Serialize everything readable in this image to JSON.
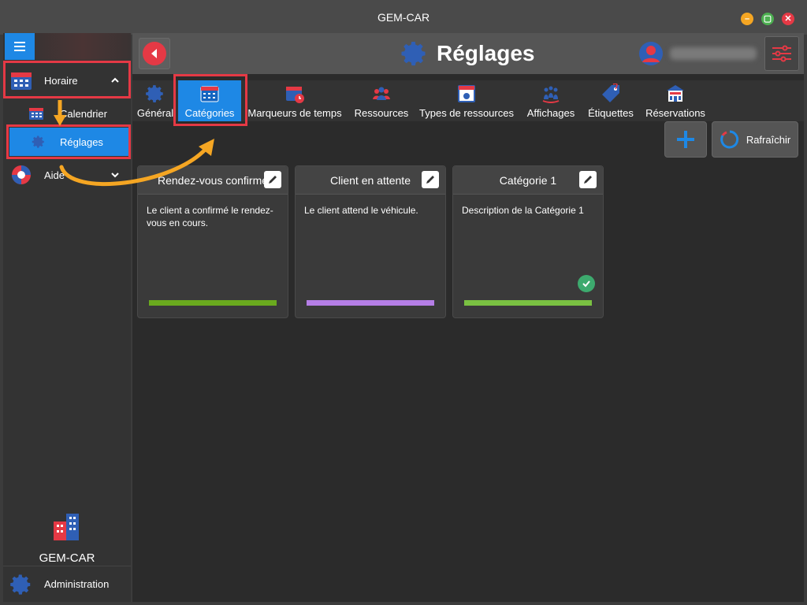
{
  "window": {
    "title": "GEM-CAR"
  },
  "sidebar": {
    "horaire_label": "Horaire",
    "calendrier_label": "Calendrier",
    "reglages_label": "Réglages",
    "aide_label": "Aide",
    "brand_label": "GEM-CAR",
    "admin_label": "Administration"
  },
  "header": {
    "title": "Réglages"
  },
  "tabs": [
    {
      "label": "Général",
      "icon": "gear-icon"
    },
    {
      "label": "Catégories",
      "icon": "calendar-icon"
    },
    {
      "label": "Marqueurs de temps",
      "icon": "calendar-clock-icon"
    },
    {
      "label": "Ressources",
      "icon": "people-icon"
    },
    {
      "label": "Types de ressources",
      "icon": "resource-type-icon"
    },
    {
      "label": "Affichages",
      "icon": "display-icon"
    },
    {
      "label": "Étiquettes",
      "icon": "tag-icon"
    },
    {
      "label": "Réservations",
      "icon": "reservation-icon"
    }
  ],
  "actions": {
    "refresh_label": "Rafraîchir"
  },
  "cards": [
    {
      "title": "Rendez-vous confirmé",
      "description": "Le client a confirmé le rendez-vous en cours.",
      "color": "#6aaa1e",
      "default": false
    },
    {
      "title": "Client en attente",
      "description": "Le client attend le véhicule.",
      "color": "#b57ee6",
      "default": false
    },
    {
      "title": "Catégorie 1",
      "description": "Description de la Catégorie 1",
      "color": "#7ac142",
      "default": true
    }
  ],
  "colors": {
    "accent": "#1e88e5",
    "highlight": "#e53945",
    "annotation_arrow": "#f5a623"
  }
}
